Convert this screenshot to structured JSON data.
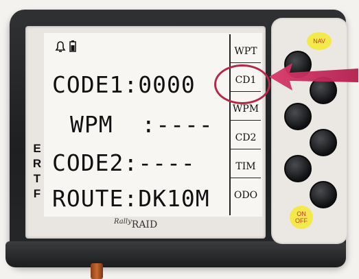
{
  "screen": {
    "rows": [
      {
        "label": "CODE1",
        "value": "0000"
      },
      {
        "label": "WPM",
        "value": "----"
      },
      {
        "label": "CODE2",
        "value": "----"
      },
      {
        "label": "ROUTE",
        "value": "DK10M"
      }
    ],
    "softkeys": [
      "WPT",
      "CD1",
      "WPM",
      "CD2",
      "TIM",
      "ODO"
    ],
    "highlighted_softkey": "CD1"
  },
  "side_letters": [
    "E",
    "R",
    "T",
    "F"
  ],
  "brand": {
    "script": "Rally",
    "name": "RAID"
  },
  "buttons": {
    "nav": "NAV",
    "onoff_line1": "ON",
    "onoff_line2": "OFF"
  },
  "colors": {
    "highlight": "#b12a48",
    "badge": "#f4e94a",
    "badge_text": "#c0392b"
  }
}
